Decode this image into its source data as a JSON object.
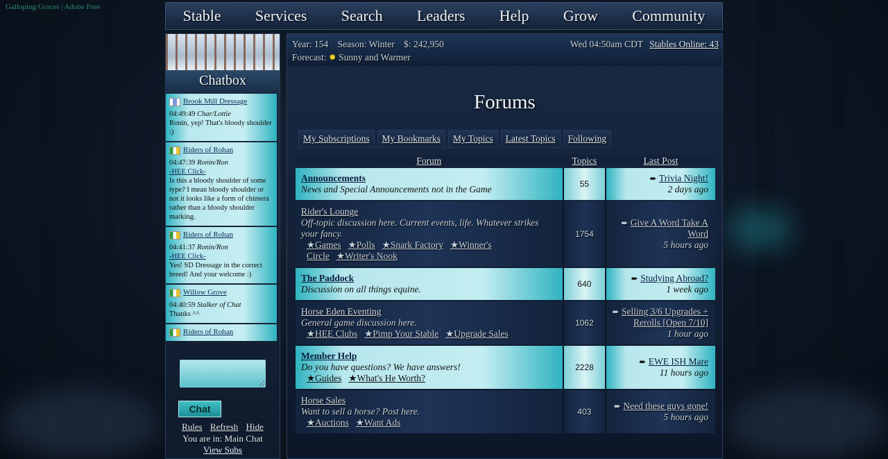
{
  "site_credit": {
    "brand": "Galloping Graces",
    "sep": "|",
    "credit": "Adobe Free"
  },
  "nav": [
    "Stable",
    "Services",
    "Search",
    "Leaders",
    "Help",
    "Grow",
    "Community"
  ],
  "chatbox": {
    "title": "Chatbox",
    "messages": [
      {
        "stable": "Brook Mill Dressage",
        "flag": "blue",
        "time": "04:49:49",
        "author": "Char/Lottie",
        "click": "",
        "text": "Ronin, yep! That's bloody shoulder :)"
      },
      {
        "stable": "Riders of Rohan",
        "flag": "green",
        "time": "04:47:39",
        "author": "Ronin/Ron",
        "click": "-HEE Click-",
        "text": "Is this a bloody shoulder of some type? I mean bloody shoulder or not it looks like a form of chimera rather than a bloody shoulder marking."
      },
      {
        "stable": "Riders of Rohan",
        "flag": "green",
        "time": "04:41:37",
        "author": "Ronin/Ron",
        "click": "-HEE Click-",
        "text": "Yes! SD Dressage in the correct breed! And your welcome :)"
      },
      {
        "stable": "Willow Grove",
        "flag": "green",
        "time": "04:40:59",
        "author": "Stalker of Chat",
        "click": "",
        "text": "Thanks ^^"
      },
      {
        "stable": "Riders of Rohan",
        "flag": "green",
        "time": "",
        "author": "",
        "click": "",
        "text": ""
      }
    ],
    "chat_button": "Chat",
    "links": [
      "Rules",
      "Refresh",
      "Hide"
    ],
    "room": "You are in: Main Chat",
    "view_subs": "View Subs"
  },
  "status": {
    "year": "Year: 154",
    "season": "Season: Winter",
    "money": "$: 242,950",
    "datetime": "Wed 04:50am CDT",
    "online": "Stables Online: 43",
    "forecast_label": "Forecast:",
    "forecast": "Sunny and Warmer"
  },
  "forums_title": "Forums",
  "tabs": [
    "My Subscriptions",
    "My Bookmarks",
    "My Topics",
    "Latest Topics",
    "Following"
  ],
  "table_headers": {
    "forum": "Forum",
    "topics": "Topics",
    "last": "Last Post"
  },
  "forums": [
    {
      "style": "light",
      "name": "Announcements",
      "desc": "News and Special Announcements not in the Game",
      "subs": [],
      "topics": "55",
      "last": "Trivia Night!",
      "ago": "2 days ago"
    },
    {
      "style": "dark",
      "name": "Rider's Lounge",
      "desc": "Off-topic discussion here. Current events, life. Whatever strikes your fancy.",
      "subs": [
        "Games",
        "Polls",
        "Snark Factory",
        "Winner's Circle",
        "Writer's Nook"
      ],
      "topics": "1754",
      "last": "Give A Word Take A Word",
      "ago": "5 hours ago"
    },
    {
      "style": "light",
      "name": "The Paddock",
      "desc": "Discussion on all things equine.",
      "subs": [],
      "topics": "640",
      "last": "Studying Abroad?",
      "ago": "1 week ago"
    },
    {
      "style": "dark",
      "name": "Horse Eden Eventing",
      "desc": "General game discussion here.",
      "subs": [
        "HEE Clubs",
        "Pimp Your Stable",
        "Upgrade Sales"
      ],
      "topics": "1062",
      "last": "Selling 3/6 Upgrades + Rerolls [Open 7/10]",
      "ago": "1 hour ago"
    },
    {
      "style": "light",
      "name": "Member Help",
      "desc": "Do you have questions? We have answers!",
      "subs": [
        "Guides",
        "What's He Worth?"
      ],
      "topics": "2228",
      "last": "EWE ISH Mare",
      "ago": "11 hours ago"
    },
    {
      "style": "dark",
      "name": "Horse Sales",
      "desc": "Want to sell a horse? Post here.",
      "subs": [
        "Auctions",
        "Want Ads"
      ],
      "topics": "403",
      "last": "Need these guys gone!",
      "ago": "5 hours ago"
    }
  ]
}
